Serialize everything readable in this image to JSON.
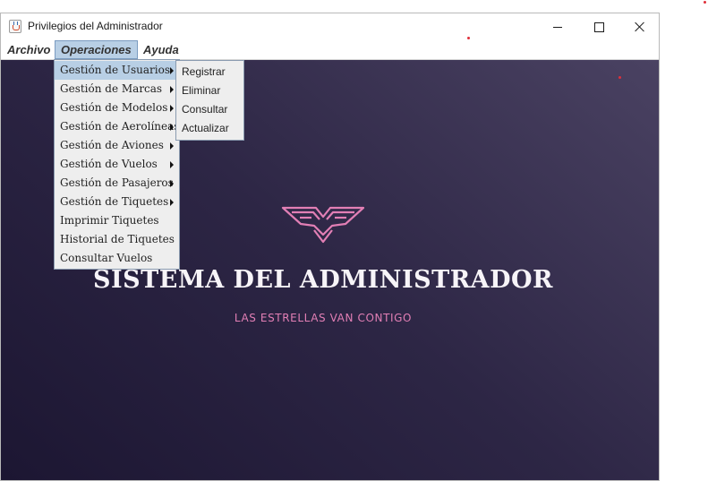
{
  "window": {
    "title": "Privilegios del Administrador"
  },
  "menubar": {
    "items": [
      "Archivo",
      "Operaciones",
      "Ayuda"
    ]
  },
  "operaciones_menu": {
    "items": [
      {
        "label": "Gestión de Usuarios",
        "submenu": true
      },
      {
        "label": "Gestión de Marcas",
        "submenu": true
      },
      {
        "label": "Gestión de Modelos",
        "submenu": true
      },
      {
        "label": "Gestión de Aerolíneas",
        "submenu": true
      },
      {
        "label": "Gestión de Aviones",
        "submenu": true
      },
      {
        "label": "Gestión de Vuelos",
        "submenu": true
      },
      {
        "label": "Gestión de Pasajeros",
        "submenu": true
      },
      {
        "label": "Gestión de Tiquetes",
        "submenu": true
      },
      {
        "label": "Imprimir Tiquetes",
        "submenu": false
      },
      {
        "label": "Historial de Tiquetes",
        "submenu": false
      },
      {
        "label": "Consultar Vuelos",
        "submenu": false
      }
    ]
  },
  "usuarios_submenu": {
    "items": [
      "Registrar",
      "Eliminar",
      "Consultar",
      "Actualizar"
    ]
  },
  "content": {
    "title": "SISTEMA DEL ADMINISTRADOR",
    "subtitle": "LAS ESTRELLAS VAN CONTIGO"
  },
  "colors": {
    "accent_pink": "#e27fb5",
    "menu_highlight": "#b8cfe5",
    "background_dark": "#1c1632"
  },
  "icons": {
    "app": "java-cup-icon",
    "logo": "eagle-wings-logo"
  }
}
